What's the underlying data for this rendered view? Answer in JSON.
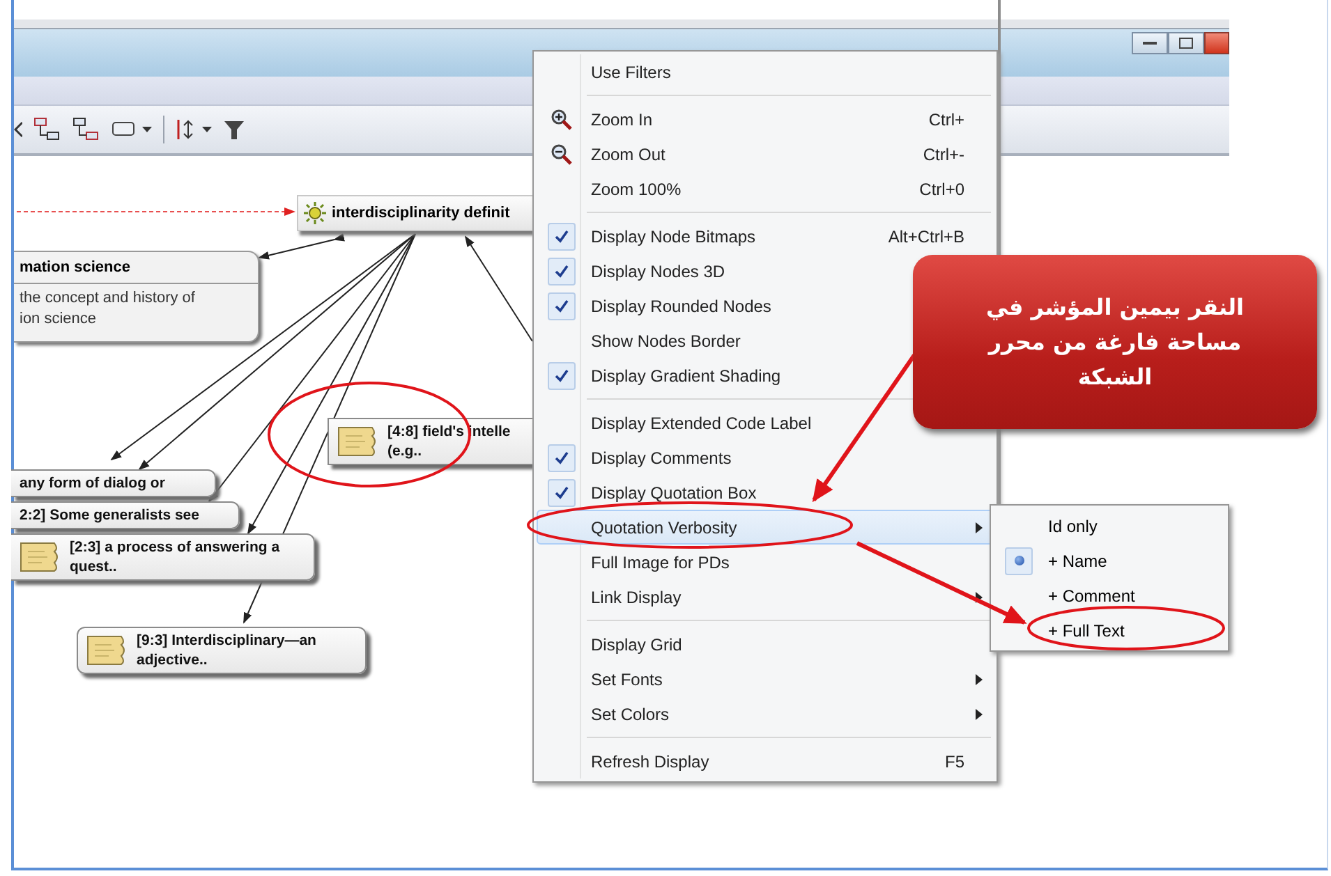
{
  "canvas": {
    "code_node": {
      "label": "interdisciplinarity definit"
    },
    "memo": {
      "title": "mation science",
      "lines": [
        "the concept and history of",
        "ion science"
      ]
    },
    "nodes": [
      {
        "kind": "fragment",
        "lines": [
          "any form of dialog or"
        ]
      },
      {
        "kind": "fragment",
        "lines": [
          "2:2] Some generalists see"
        ]
      },
      {
        "kind": "quotation",
        "lines": [
          "[2:3] a process of answering a",
          "quest.."
        ]
      },
      {
        "kind": "quotation",
        "lines": [
          "[4:8] field's intelle",
          "(e.g.."
        ]
      },
      {
        "kind": "quotation",
        "lines": [
          "[9:3]  Interdisciplinary—an",
          "adjective.."
        ]
      }
    ]
  },
  "context_menu": {
    "items": [
      {
        "kind": "item",
        "label": "Use Filters",
        "checked": false,
        "selected": false
      },
      {
        "kind": "separator"
      },
      {
        "kind": "zoom",
        "label": "Zoom In",
        "shortcut": "Ctrl+",
        "selected": false
      },
      {
        "kind": "zoom",
        "label": "Zoom Out",
        "shortcut": "Ctrl+-",
        "selected": false
      },
      {
        "kind": "item",
        "label": "Zoom 100%",
        "shortcut": "Ctrl+0",
        "checked": false,
        "selected": false
      },
      {
        "kind": "separator"
      },
      {
        "kind": "item",
        "label": "Display Node Bitmaps",
        "shortcut": "Alt+Ctrl+B",
        "checked": true,
        "selected": false
      },
      {
        "kind": "item",
        "label": "Display Nodes 3D",
        "checked": true,
        "selected": false
      },
      {
        "kind": "item",
        "label": "Display Rounded Nodes",
        "checked": true,
        "selected": false
      },
      {
        "kind": "item",
        "label": "Show Nodes Border",
        "checked": false,
        "selected": false
      },
      {
        "kind": "item",
        "label": "Display Gradient Shading",
        "checked": true,
        "selected": false
      },
      {
        "kind": "separator"
      },
      {
        "kind": "item",
        "label": "Display Extended Code Label",
        "checked": false,
        "selected": false
      },
      {
        "kind": "item",
        "label": "Display Comments",
        "checked": true,
        "selected": false
      },
      {
        "kind": "item",
        "label": "Display Quotation Box",
        "checked": true,
        "selected": false
      },
      {
        "kind": "submenu",
        "label": "Quotation Verbosity",
        "checked": false,
        "selected": true
      },
      {
        "kind": "item",
        "label": "Full Image for PDs",
        "checked": false,
        "selected": false
      },
      {
        "kind": "submenu",
        "label": "Link Display",
        "checked": false,
        "selected": false
      },
      {
        "kind": "separator"
      },
      {
        "kind": "item",
        "label": "Display Grid",
        "checked": false,
        "selected": false
      },
      {
        "kind": "submenu",
        "label": "Set Fonts",
        "checked": false,
        "selected": false
      },
      {
        "kind": "submenu",
        "label": "Set Colors",
        "checked": false,
        "selected": false
      },
      {
        "kind": "separator"
      },
      {
        "kind": "item",
        "label": "Refresh Display",
        "shortcut": "F5",
        "checked": false,
        "selected": false
      }
    ]
  },
  "submenu": {
    "items": [
      {
        "label": "Id only",
        "selected": false
      },
      {
        "label": "+ Name",
        "selected": true
      },
      {
        "label": "+ Comment",
        "selected": false
      },
      {
        "label": "+ Full Text",
        "selected": false
      }
    ]
  },
  "callout": {
    "text": "النقر بيمين المؤشر في مساحة فارغة من محرر الشبكة"
  }
}
